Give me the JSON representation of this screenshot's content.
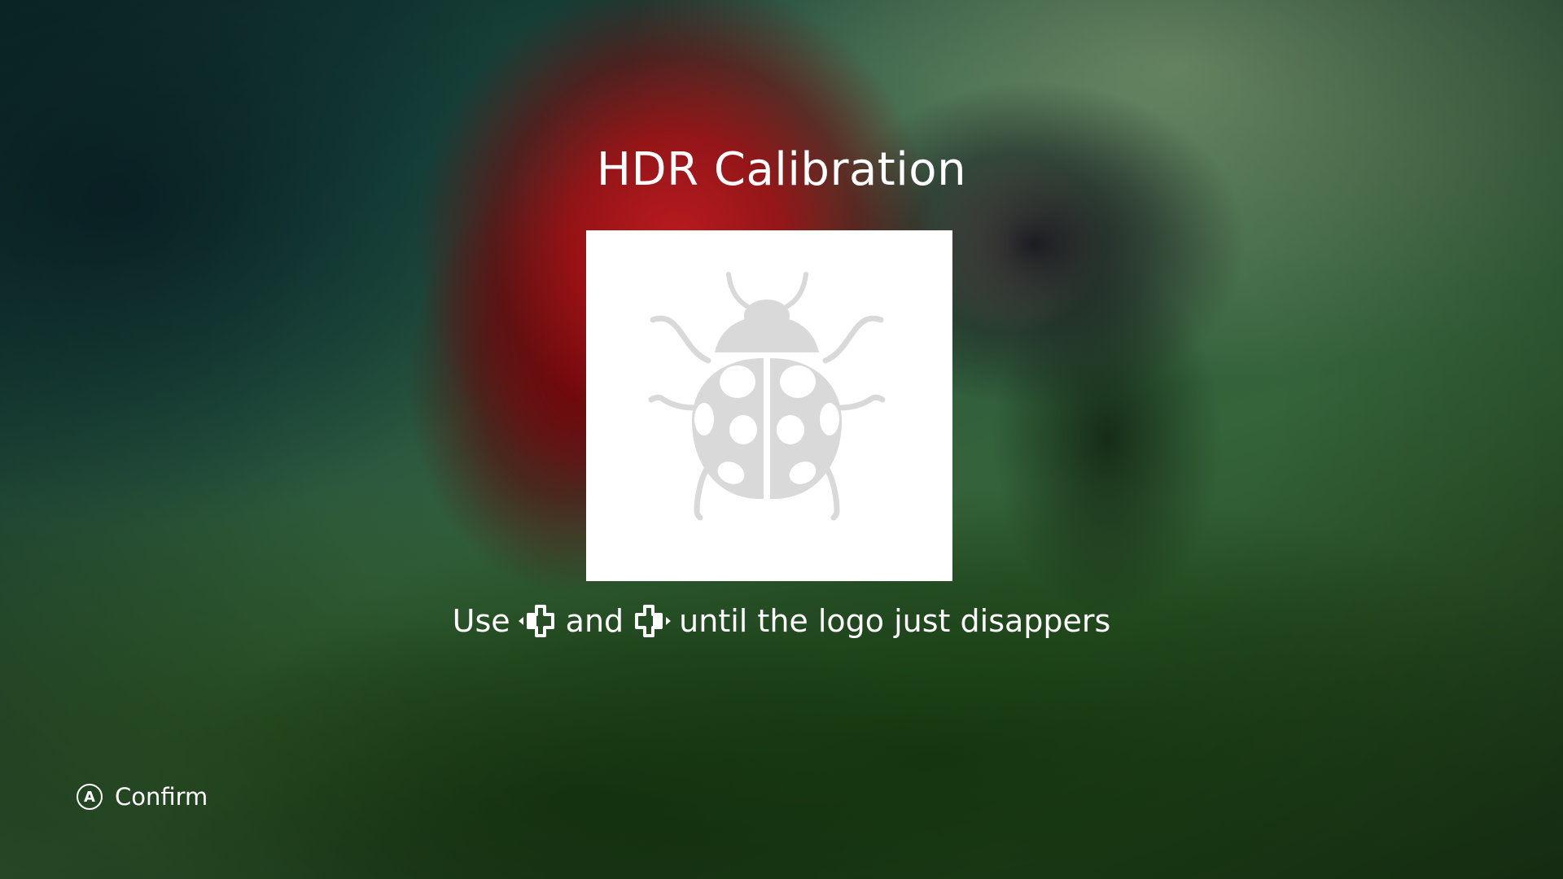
{
  "screen": {
    "title": "HDR Calibration"
  },
  "calibration": {
    "logo_icon": "ladybug-icon",
    "logo_color": "#d9d9d9",
    "box_color": "#ffffff"
  },
  "instruction": {
    "prefix": "Use",
    "left_control_icon": "dpad-left-icon",
    "middle": "and",
    "right_control_icon": "dpad-right-icon",
    "suffix": "until the logo just disappers"
  },
  "footer": {
    "confirm_button_glyph": "A",
    "confirm_label": "Confirm"
  }
}
